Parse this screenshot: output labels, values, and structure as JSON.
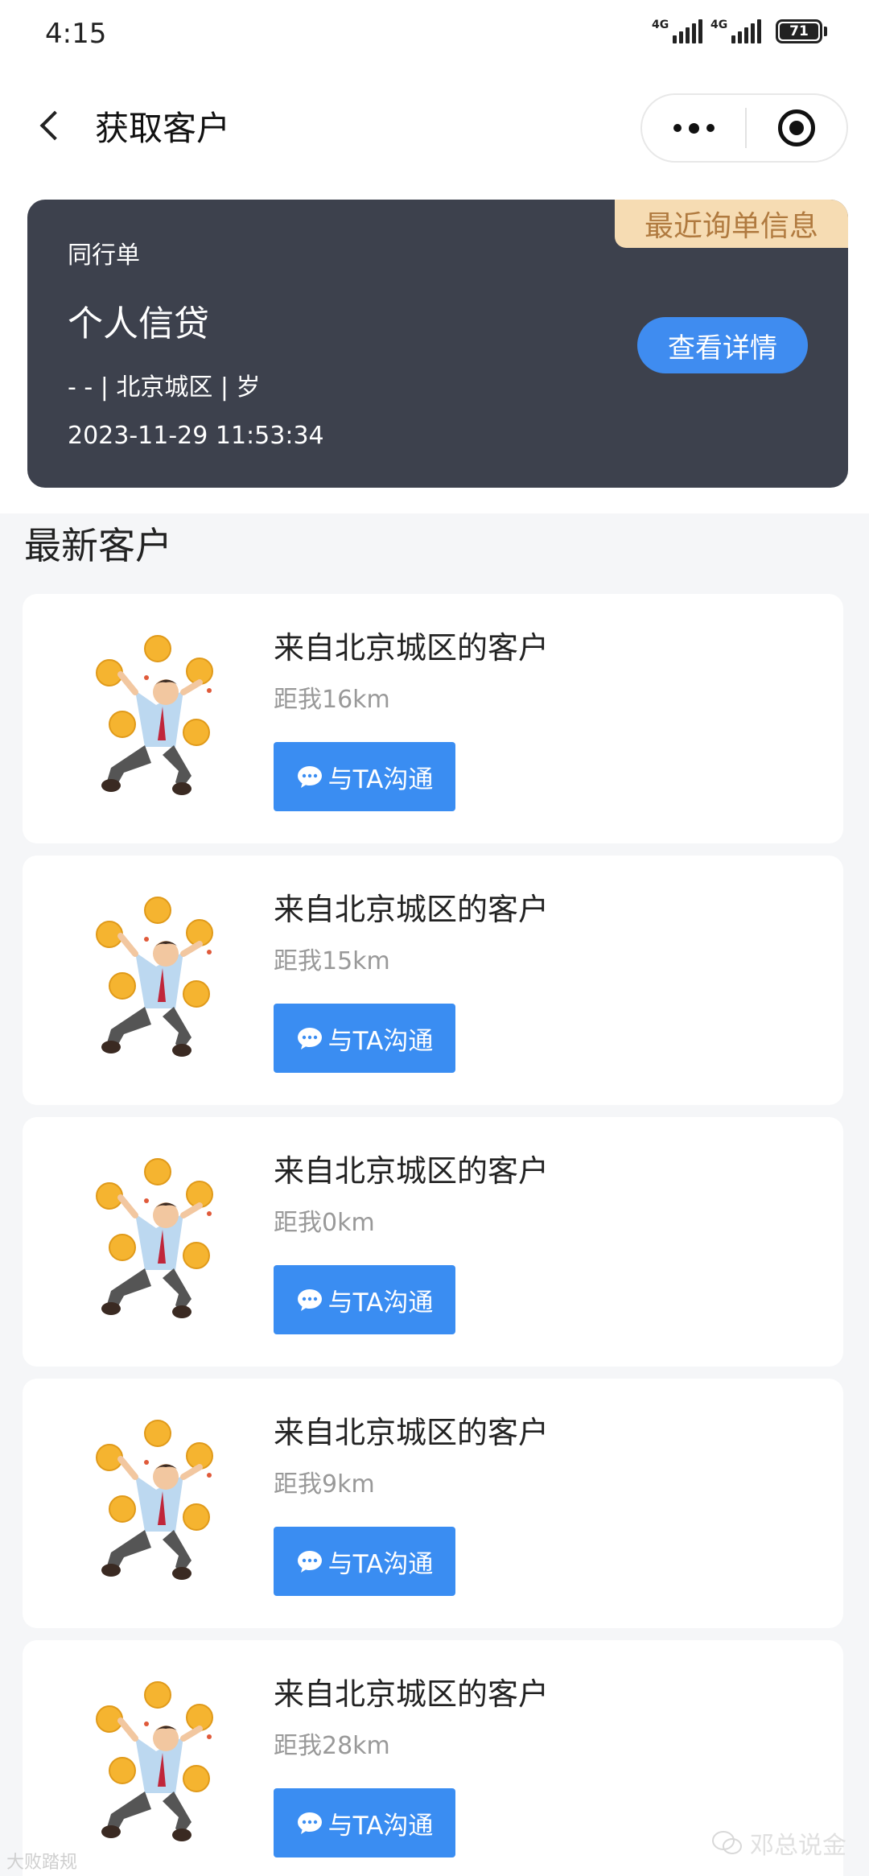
{
  "status_bar": {
    "time": "4:15",
    "signal_1_label": "4G",
    "signal_2_label": "4G",
    "battery": "71"
  },
  "nav": {
    "title": "获取客户"
  },
  "recent_order": {
    "tag": "最近询单信息",
    "type": "同行单",
    "product": "个人信贷",
    "meta": "- - | 北京城区 | 岁",
    "time": "2023-11-29 11:53:34",
    "detail_button": "查看详情"
  },
  "section_title": "最新客户",
  "customers": [
    {
      "title": "来自北京城区的客户",
      "distance": "距我16km",
      "chat_label": "与TA沟通"
    },
    {
      "title": "来自北京城区的客户",
      "distance": "距我15km",
      "chat_label": "与TA沟通"
    },
    {
      "title": "来自北京城区的客户",
      "distance": "距我0km",
      "chat_label": "与TA沟通"
    },
    {
      "title": "来自北京城区的客户",
      "distance": "距我9km",
      "chat_label": "与TA沟通"
    },
    {
      "title": "来自北京城区的客户",
      "distance": "距我28km",
      "chat_label": "与TA沟通"
    }
  ],
  "watermarks": {
    "left": "大败踏规",
    "right": "邓总说金"
  },
  "colors": {
    "accent_blue": "#3a8df2",
    "card_dark": "#3d414d",
    "tag_bg": "#f6dcb3",
    "tag_text": "#b07a3f"
  }
}
